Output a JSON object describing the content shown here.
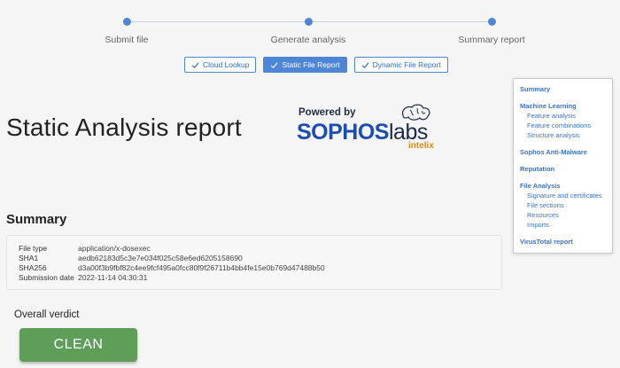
{
  "stepper": {
    "steps": [
      {
        "label": "Submit file"
      },
      {
        "label": "Generate analysis"
      },
      {
        "label": "Summary report"
      }
    ]
  },
  "tabs": [
    {
      "label": "Cloud Lookup",
      "active": false
    },
    {
      "label": "Static File Report",
      "active": true
    },
    {
      "label": "Dynamic File Report",
      "active": false
    }
  ],
  "page": {
    "title": "Static Analysis report"
  },
  "logo": {
    "powered_by": "Powered by",
    "brand": "SOPHOS",
    "brand_suffix": "labs",
    "product": "intelix"
  },
  "summary": {
    "title": "Summary",
    "rows": [
      {
        "key": "File type",
        "value": "application/x-dosexec"
      },
      {
        "key": "SHA1",
        "value": "aedb62183d5c3e7e034f025c58e6ed6205158690"
      },
      {
        "key": "SHA256",
        "value": "d3a00f3b9fbf82c4ee9fcf495a0fcc80f9f26711b4bb4fe15e0b769d47488b50"
      },
      {
        "key": "Submission date",
        "value": "2022-11-14 04:30:31"
      }
    ]
  },
  "verdict": {
    "title": "Overall verdict",
    "value": "CLEAN",
    "color": "#5f9e59"
  },
  "nav": {
    "summary": "Summary",
    "machine_learning": "Machine Learning",
    "feature_analysis": "Feature analysis",
    "feature_combinations": "Feature combinations",
    "structure_analysis": "Structure analysis",
    "anti_malware": "Sophos Anti-Malware",
    "reputation": "Reputation",
    "file_analysis": "File Analysis",
    "signature": "Signature and certificates",
    "file_sections": "File sections",
    "resources": "Resources",
    "imports": "Imports",
    "virustotal": "VirusTotal report"
  },
  "colors": {
    "accent": "#4d86d6",
    "logo_blue": "#1c4db3",
    "logo_orange": "#e08a1b"
  }
}
